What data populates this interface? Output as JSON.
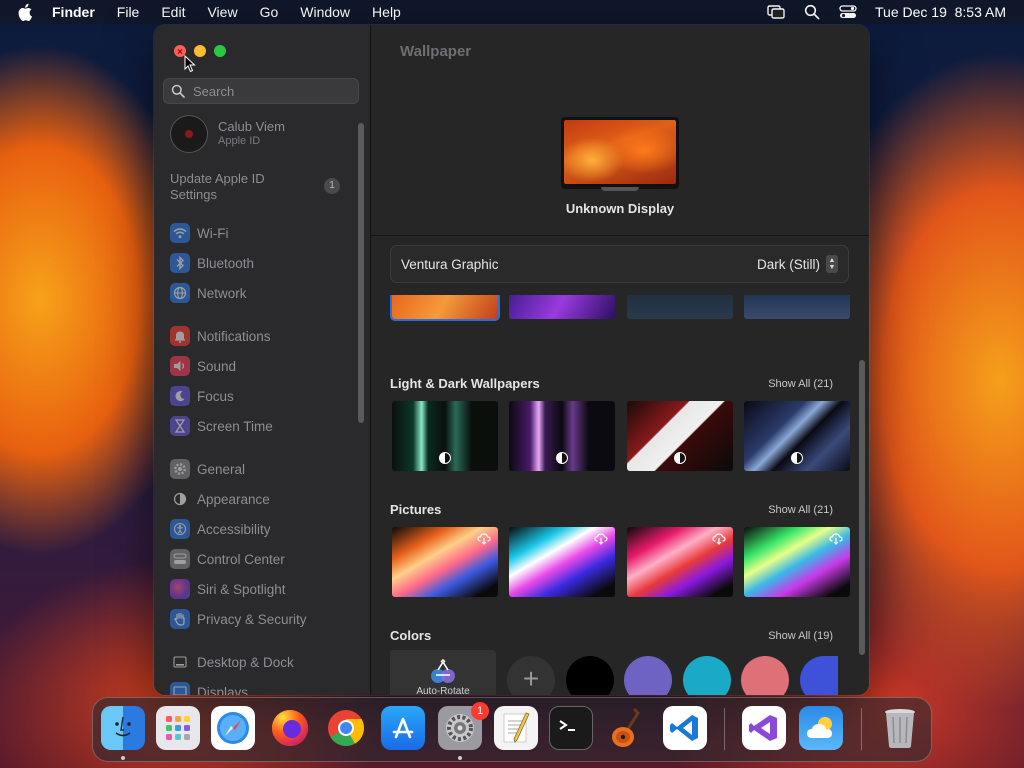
{
  "menubar": {
    "app": "Finder",
    "items": [
      "File",
      "Edit",
      "View",
      "Go",
      "Window",
      "Help"
    ],
    "datetime": "Tue Dec 19  8:53 AM",
    "icons": [
      "apple-icon",
      "screen-mirroring-icon",
      "spotlight-search-icon",
      "control-center-icon"
    ]
  },
  "sidebar": {
    "search_placeholder": "Search",
    "profile": {
      "name": "Calub Viem",
      "subtitle": "Apple ID"
    },
    "update": {
      "label": "Update Apple ID Settings",
      "badge": "1"
    },
    "items": [
      {
        "label": "Wi-Fi",
        "icon": "wifi-icon",
        "color": "#2f7ff0"
      },
      {
        "label": "Bluetooth",
        "icon": "bluetooth-icon",
        "color": "#2f7ff0"
      },
      {
        "label": "Network",
        "icon": "globe-icon",
        "color": "#2f7ff0"
      },
      {
        "label": "Notifications",
        "icon": "bell-icon",
        "color": "#ff3b30"
      },
      {
        "label": "Sound",
        "icon": "speaker-icon",
        "color": "#ff3b60"
      },
      {
        "label": "Focus",
        "icon": "moon-icon",
        "color": "#6a5ae0"
      },
      {
        "label": "Screen Time",
        "icon": "hourglass-icon",
        "color": "#6a5ae0"
      },
      {
        "label": "General",
        "icon": "gear-icon",
        "color": "#8e8e93"
      },
      {
        "label": "Appearance",
        "icon": "appearance-icon",
        "color": "#2a2a2a"
      },
      {
        "label": "Accessibility",
        "icon": "accessibility-icon",
        "color": "#2f7ff0"
      },
      {
        "label": "Control Center",
        "icon": "control-center-icon",
        "color": "#8e8e93"
      },
      {
        "label": "Siri & Spotlight",
        "icon": "siri-icon",
        "color": "#c040e0"
      },
      {
        "label": "Privacy & Security",
        "icon": "hand-icon",
        "color": "#2f7ff0"
      },
      {
        "label": "Desktop & Dock",
        "icon": "dock-icon",
        "color": "#2a2a2a"
      },
      {
        "label": "Displays",
        "icon": "display-icon",
        "color": "#2f7ff0"
      }
    ]
  },
  "main": {
    "title": "Wallpaper",
    "display_name": "Unknown Display",
    "picker": {
      "wallpaper": "Ventura Graphic",
      "mode": "Dark (Still)"
    },
    "sections": [
      {
        "title": "Light & Dark Wallpapers",
        "show_all": "Show All (21)"
      },
      {
        "title": "Pictures",
        "show_all": "Show All (21)"
      },
      {
        "title": "Colors",
        "show_all": "Show All (19)"
      }
    ],
    "auto_rotate": "Auto-Rotate",
    "colors": [
      "#000000",
      "#6e62c2",
      "#1aaac8",
      "#e07078",
      "#3d52d8"
    ]
  },
  "dock": {
    "apps": [
      {
        "name": "Finder",
        "icon": "finder-icon",
        "running": true
      },
      {
        "name": "Launchpad",
        "icon": "launchpad-icon"
      },
      {
        "name": "Safari",
        "icon": "safari-icon"
      },
      {
        "name": "Firefox",
        "icon": "firefox-icon"
      },
      {
        "name": "Chrome",
        "icon": "chrome-icon"
      },
      {
        "name": "App Store",
        "icon": "app-store-icon"
      },
      {
        "name": "System Settings",
        "icon": "system-settings-icon",
        "running": true,
        "badge": "1"
      },
      {
        "name": "TextEdit",
        "icon": "textedit-icon"
      },
      {
        "name": "Terminal",
        "icon": "terminal-icon"
      },
      {
        "name": "GarageBand",
        "icon": "garageband-icon"
      },
      {
        "name": "Visual Studio Code",
        "icon": "vscode-icon"
      },
      {
        "name": "Visual Studio",
        "icon": "visual-studio-icon"
      },
      {
        "name": "Weather",
        "icon": "weather-icon"
      },
      {
        "name": "Trash",
        "icon": "trash-icon"
      }
    ]
  }
}
